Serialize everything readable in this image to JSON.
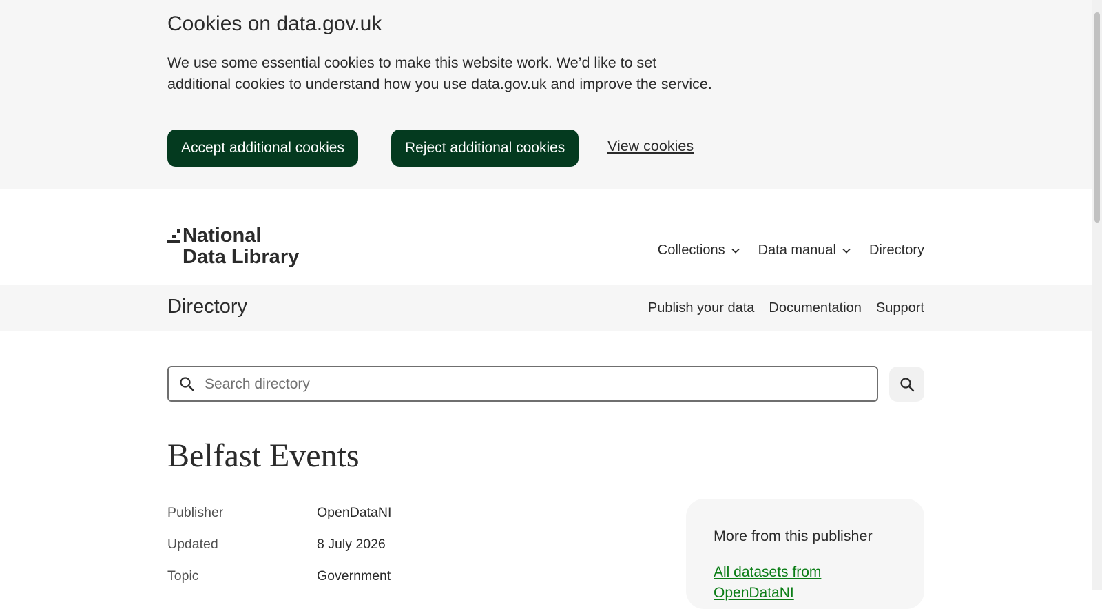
{
  "cookie_banner": {
    "title": "Cookies on data.gov.uk",
    "text": "We use some essential cookies to make this website work. We’d like to set additional cookies to understand how you use data.gov.uk and improve the service.",
    "accept_label": "Accept additional cookies",
    "reject_label": "Reject additional cookies",
    "view_label": "View cookies"
  },
  "header": {
    "logo_line1": "National",
    "logo_line2": "Data Library",
    "nav": [
      {
        "label": "Collections",
        "icon": "chevron-down-icon"
      },
      {
        "label": "Data manual",
        "icon": "chevron-down-icon"
      },
      {
        "label": "Directory"
      }
    ]
  },
  "subheader": {
    "title": "Directory",
    "links": [
      "Publish your data",
      "Documentation",
      "Support"
    ]
  },
  "search": {
    "placeholder": "Search directory",
    "value": "",
    "icon": "search-icon",
    "button_icon": "search-icon"
  },
  "dataset": {
    "title": "Belfast Events",
    "meta": [
      {
        "key": "Publisher",
        "value": "OpenDataNI"
      },
      {
        "key": "Updated",
        "value": "8 July 2026"
      },
      {
        "key": "Topic",
        "value": "Government"
      }
    ]
  },
  "sidebar_card": {
    "heading": "More from this publisher",
    "link": "All datasets from OpenDataNI"
  },
  "colors": {
    "brand_dark_green": "#043a1f",
    "link_green": "#0b7d16",
    "banner_bg": "#f6f6f6",
    "text": "#2b2b2b"
  }
}
